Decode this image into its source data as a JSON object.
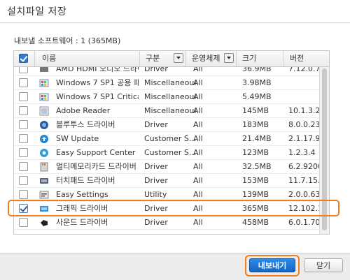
{
  "window": {
    "title": "설치파일 저장"
  },
  "summary": "내보낼 소프트웨어 : 1 (365MB)",
  "table": {
    "columns": {
      "name": "이름",
      "type": "구분",
      "os": "운영체제",
      "size": "크기",
      "version": "버전"
    },
    "rows": [
      {
        "checked": false,
        "icon": "driver-icon",
        "name": "AMD HDMI 오디오 드라이버",
        "type": "Driver",
        "os": "All",
        "size": "36.9MB",
        "version": "7.12.0.7"
      },
      {
        "checked": false,
        "icon": "windows-update-icon",
        "name": "Windows 7 SP1 공용 패치",
        "type": "Miscellaneous",
        "os": "All",
        "size": "3.98MB",
        "version": ""
      },
      {
        "checked": false,
        "icon": "windows-update-icon",
        "name": "Windows 7 SP1 Critical...",
        "type": "Miscellaneous",
        "os": "All",
        "size": "5.49MB",
        "version": ""
      },
      {
        "checked": false,
        "icon": "adobe-reader-icon",
        "name": "Adobe Reader",
        "type": "Miscellaneous",
        "os": "All",
        "size": "145MB",
        "version": "10.1.3.23"
      },
      {
        "checked": false,
        "icon": "bluetooth-icon",
        "name": "블루투스 드라이버",
        "type": "Driver",
        "os": "All",
        "size": "183MB",
        "version": "8.0.0.230"
      },
      {
        "checked": false,
        "icon": "sw-update-icon",
        "name": "SW Update",
        "type": "Customer S...",
        "os": "All",
        "size": "21.4MB",
        "version": "2.1.17.9"
      },
      {
        "checked": false,
        "icon": "support-center-icon",
        "name": "Easy Support Center",
        "type": "Customer S...",
        "os": "All",
        "size": "123MB",
        "version": "1.2.3.4"
      },
      {
        "checked": false,
        "icon": "memory-card-icon",
        "name": "멀티메모리카드 드라이버",
        "type": "Driver",
        "os": "All",
        "size": "32.5MB",
        "version": "6.2.9200.30"
      },
      {
        "checked": false,
        "icon": "touchpad-icon",
        "name": "터치패드 드라이버",
        "type": "Driver",
        "os": "All",
        "size": "153MB",
        "version": "11.7.15.3"
      },
      {
        "checked": false,
        "icon": "settings-icon",
        "name": "Easy Settings",
        "type": "Utility",
        "os": "All",
        "size": "139MB",
        "version": "2.0.0.63"
      },
      {
        "checked": true,
        "icon": "graphics-icon",
        "name": "그래픽 드라이버",
        "type": "Driver",
        "os": "All",
        "size": "365MB",
        "version": "12.102.1.2"
      },
      {
        "checked": false,
        "icon": "sound-icon",
        "name": "사운드 드라이버",
        "type": "Driver",
        "os": "All",
        "size": "458MB",
        "version": "6.0.1.7032"
      }
    ]
  },
  "buttons": {
    "export": "내보내기",
    "close": "닫기"
  }
}
